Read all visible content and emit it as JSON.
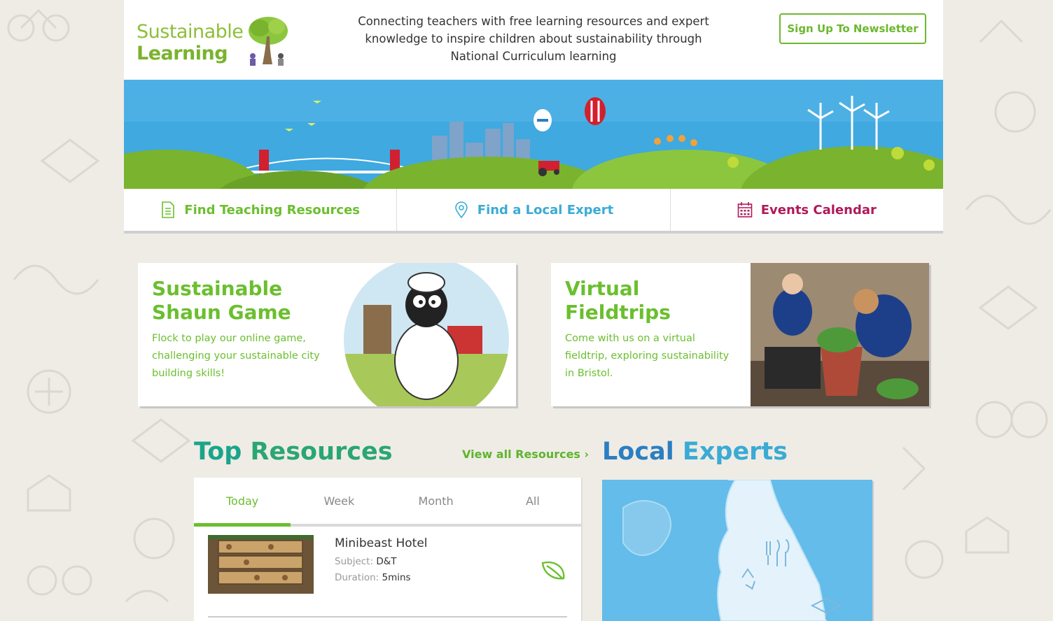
{
  "header": {
    "logo_line1": "Sustainable",
    "logo_line2": "Learning",
    "tagline": "Connecting teachers with free learning resources and expert knowledge to inspire children about sustainability through National Curriculum learning",
    "newsletter_label": "Sign Up To Newsletter"
  },
  "nav": {
    "items": [
      {
        "label": "Find Teaching Resources",
        "icon": "document-icon",
        "color": "#6bbf2e"
      },
      {
        "label": "Find a Local Expert",
        "icon": "location-pin-icon",
        "color": "#3aabd4"
      },
      {
        "label": "Events Calendar",
        "icon": "calendar-icon",
        "color": "#b0195a"
      }
    ]
  },
  "features": [
    {
      "title": "Sustainable Shaun Game",
      "desc": "Flock to play our online game, challenging your sustainable city building skills!"
    },
    {
      "title": "Virtual Fieldtrips",
      "desc": "Come with us on a virtual fieldtrip, exploring sustainability in Bristol."
    }
  ],
  "top_resources": {
    "title_word1": "Top",
    "title_word2": "Resources",
    "view_all": "View all Resources ›",
    "tabs": [
      "Today",
      "Week",
      "Month",
      "All"
    ],
    "active_tab": "Today",
    "items": [
      {
        "title": "Minibeast Hotel",
        "subject_label": "Subject:",
        "subject": "D&T",
        "duration_label": "Duration:",
        "duration": "5mins"
      }
    ]
  },
  "local_experts": {
    "title_word1": "Local",
    "title_word2": "Experts"
  },
  "colors": {
    "green": "#6bbf2e",
    "teal": "#1aa58a",
    "blue": "#2b7fc1",
    "sky": "#3aabd4",
    "magenta": "#b0195a"
  }
}
